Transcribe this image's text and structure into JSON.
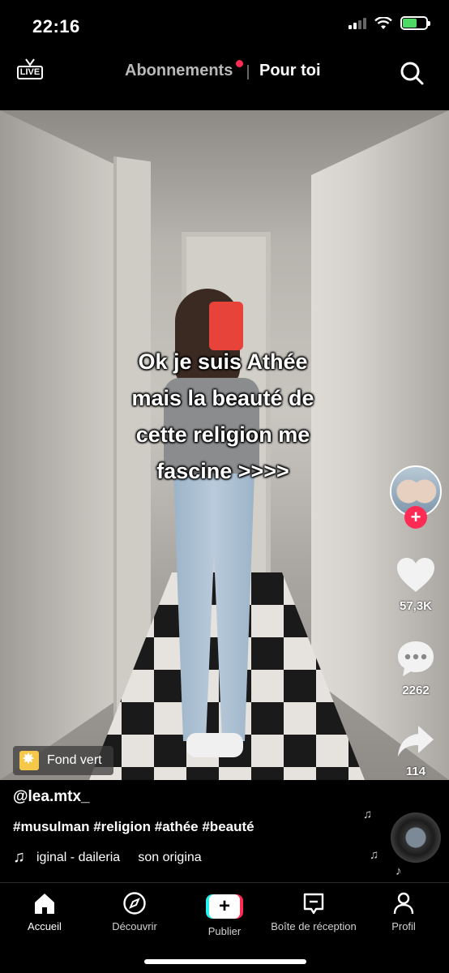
{
  "status_bar": {
    "time": "22:16",
    "battery_level": 0.62,
    "battery_color": "#4cd964"
  },
  "top_nav": {
    "live_label": "LIVE",
    "tab_following": "Abonnements",
    "tab_for_you": "Pour toi",
    "notification_dot_color": "#fe2c55"
  },
  "video": {
    "caption_lines": [
      "Ok je suis Athée",
      "mais la beauté de",
      "cette religion me",
      "fascine >>>>"
    ],
    "effect_label": "Fond vert"
  },
  "actions": {
    "likes": "57,3K",
    "comments": "2262",
    "shares": "114"
  },
  "post": {
    "username": "@lea.mtx_",
    "hashtags": "#musulman #religion #athée #beauté",
    "sound": "iginal - daileria     son origina"
  },
  "bottom_nav": {
    "home": "Accueil",
    "discover": "Découvrir",
    "publish": "Publier",
    "inbox": "Boîte de réception",
    "profile": "Profil"
  },
  "colors": {
    "accent": "#fe2c55",
    "cyan": "#25f4ee"
  },
  "icons": [
    "live-icon",
    "search-icon",
    "heart-icon",
    "comment-icon",
    "share-icon",
    "music-note-icon",
    "home-icon",
    "compass-icon",
    "plus-icon",
    "inbox-icon",
    "profile-icon"
  ]
}
